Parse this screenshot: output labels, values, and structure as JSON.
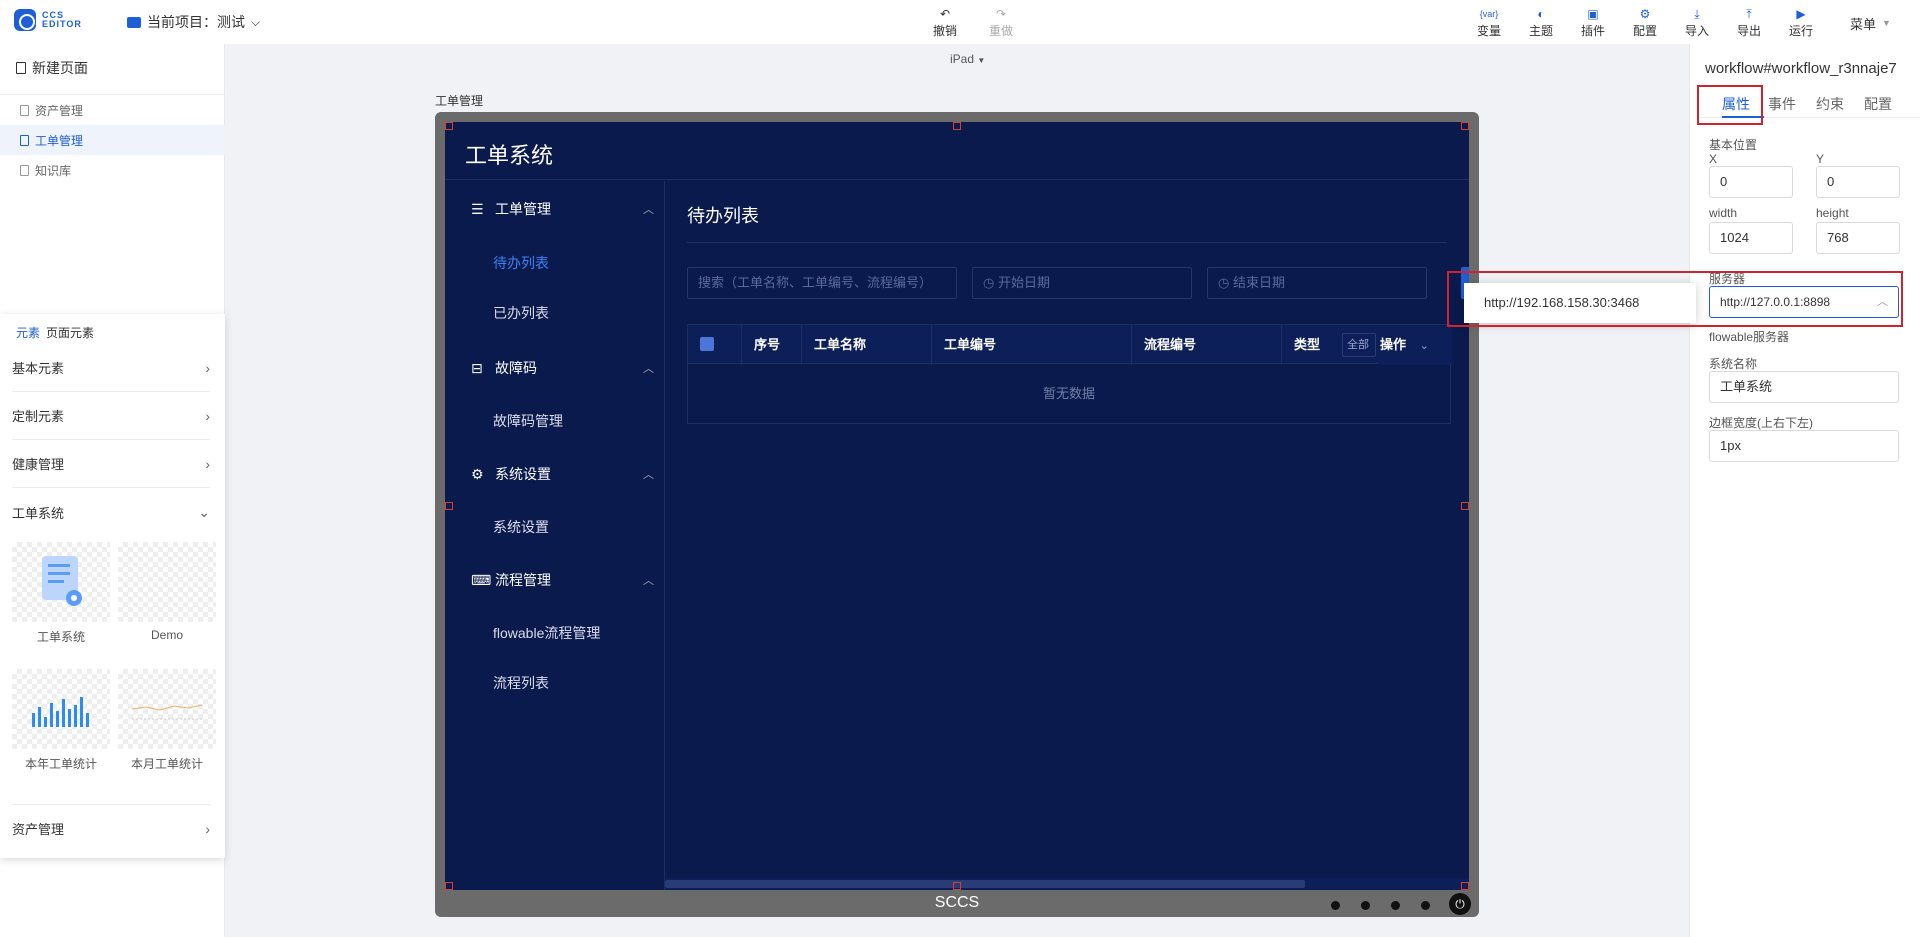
{
  "toolbar": {
    "logo_line1": "CCS",
    "logo_line2": "EDITOR",
    "project_label": "当前项目：测试",
    "undo": "撤销",
    "redo": "重做",
    "tools": [
      "变量",
      "主题",
      "插件",
      "配置",
      "导入",
      "导出",
      "运行"
    ],
    "var_icon_text": "{var}",
    "menu": "菜单"
  },
  "left": {
    "new_page": "新建页面",
    "pages": [
      {
        "label": "资产管理",
        "active": false
      },
      {
        "label": "工单管理",
        "active": true
      },
      {
        "label": "知识库",
        "active": false
      }
    ],
    "tabs": [
      "元素",
      "页面元素"
    ],
    "categories": [
      "基本元素",
      "定制元素",
      "健康管理",
      "工单系统",
      "资产管理"
    ],
    "components": [
      "工单系统",
      "Demo",
      "本年工单统计",
      "本月工单统计"
    ]
  },
  "canvas": {
    "device": "iPad",
    "page_label": "工单管理",
    "footer": "SCCS"
  },
  "app": {
    "title": "工单系统",
    "menu_groups": [
      {
        "label": "工单管理",
        "items": [
          "待办列表",
          "已办列表"
        ]
      },
      {
        "label": "故障码",
        "items": [
          "故障码管理"
        ]
      },
      {
        "label": "系统设置",
        "items": [
          "系统设置"
        ]
      },
      {
        "label": "流程管理",
        "items": [
          "flowable流程管理",
          "流程列表"
        ]
      }
    ],
    "active_item": "待办列表",
    "content_title": "待办列表",
    "search_placeholder": "搜索（工单名称、工单编号、流程编号）",
    "start_date": "开始日期",
    "end_date": "结束日期",
    "columns": [
      "序号",
      "工单名称",
      "工单编号",
      "流程编号",
      "类型",
      "操作"
    ],
    "type_filter": "全部",
    "empty": "暂无数据"
  },
  "right": {
    "title": "workflow#workflow_r3nnaje7",
    "tabs": [
      "属性",
      "事件",
      "约束",
      "配置"
    ],
    "basic_position": "基本位置",
    "x_label": "X",
    "y_label": "Y",
    "x": "0",
    "y": "0",
    "width_label": "width",
    "height_label": "height",
    "width": "1024",
    "height": "768",
    "server_label": "服务器",
    "server_value": "http://127.0.0.1:8898",
    "server_option": "http://192.168.158.30:3468",
    "flowable_label": "flowable服务器",
    "system_name_label": "系统名称",
    "system_name": "工单系统",
    "border_label": "边框宽度(上右下左)",
    "border_value": "1px"
  },
  "colors": {
    "accent": "#1f5fd6",
    "app_bg": "#0b1a4c",
    "highlight_red": "#d0232e"
  }
}
